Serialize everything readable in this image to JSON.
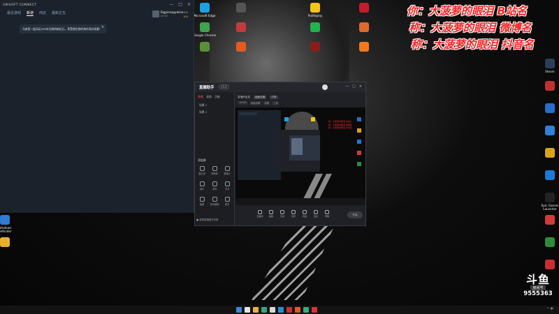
{
  "desktop": {
    "icons_top": [
      {
        "label": "Microsoft Edge",
        "color": "#1da1e3"
      },
      {
        "label": "",
        "color": "#555555"
      },
      {
        "label": "ProReplay",
        "color": "#f5c518"
      },
      {
        "label": "",
        "color": "#c21d2b"
      },
      {
        "label": "Google Chrome",
        "color": "#3fa34d"
      },
      {
        "label": "",
        "color": "#c23b3b"
      },
      {
        "label": "",
        "color": "#24b24b"
      },
      {
        "label": "",
        "color": "#e06930"
      },
      {
        "label": "",
        "color": "#5a8f3a"
      },
      {
        "label": "",
        "color": "#e65a20"
      },
      {
        "label": "",
        "color": "#8b1c1c"
      },
      {
        "label": "",
        "color": "#f07a1a"
      }
    ],
    "icons_left": [
      {
        "label": "Windows Defender",
        "color": "#2f7bd6"
      },
      {
        "label": "",
        "color": "#e8b12b"
      }
    ],
    "icons_right": [
      {
        "label": "Steam",
        "color": "#2a3f5a"
      },
      {
        "label": "",
        "color": "#c22f2f"
      },
      {
        "label": "",
        "color": "#2a6dc9"
      },
      {
        "label": "",
        "color": "#2f82d9"
      },
      {
        "label": "",
        "color": "#d8a21d"
      },
      {
        "label": "",
        "color": "#1a7bd6"
      },
      {
        "label": "Epic Games Launcher",
        "color": "#222222"
      },
      {
        "label": "",
        "color": "#d23b3b"
      },
      {
        "label": "",
        "color": "#2e8b3a"
      },
      {
        "label": "",
        "color": "#c92f2f"
      }
    ]
  },
  "ubisoft": {
    "title": "UBISOFT CONNECT",
    "nav": [
      "最近游戏",
      "新游",
      "商店",
      "最新正在"
    ],
    "nav_active_index": 1,
    "username": "Bigpineapplelea",
    "level": "LV 43",
    "coins": [
      "100",
      "100"
    ],
    "notice": "马来西一起兵玩205年日前的新纪元，享受前往首的海外奇幻场景!",
    "close": "×",
    "controls": [
      "—",
      "□",
      "×"
    ]
  },
  "streaming": {
    "logo": "直播助手",
    "version": "v5.0",
    "controls": [
      "—",
      "□",
      "×"
    ],
    "tabs": [
      "场景",
      "道具",
      "功能"
    ],
    "scenes": [
      "场景 1",
      "场景 2"
    ],
    "add_source": "添加源",
    "source_buttons": [
      "图片源",
      "视频源",
      "摄像头",
      "窗口",
      "游戏",
      "文本",
      "截图",
      "游戏截图",
      "更多"
    ],
    "main_tabs": [
      "直播间信息",
      "画面设置",
      "分享"
    ],
    "main_row": [
      "1080P",
      "画面设置",
      "效果",
      "工具"
    ],
    "bottom_buttons": [
      "直播间",
      "美颜",
      "互动",
      "音乐",
      "转盘",
      "连麦",
      "录像"
    ],
    "live_button": "开始",
    "mode_text": "■ 竖屏直播模式切换"
  },
  "overlay": {
    "lines": [
      "你：大菠萝的眼泪   B站名",
      "称：大菠萝的眼泪  微博名",
      "称：大菠萝的眼泪  抖音名"
    ]
  },
  "taskbar": {
    "icons": [
      "#3a87e0",
      "#e6e6e6",
      "#f2b230",
      "#2faa7a",
      "#d8d8d8",
      "#1e90d8",
      "#c92f2f",
      "#e65a20",
      "#30b07a",
      "#d33"
    ],
    "tray": "^ 中"
  },
  "watermark": {
    "logo": "斗鱼",
    "label": "房间号",
    "number": "9555363"
  }
}
